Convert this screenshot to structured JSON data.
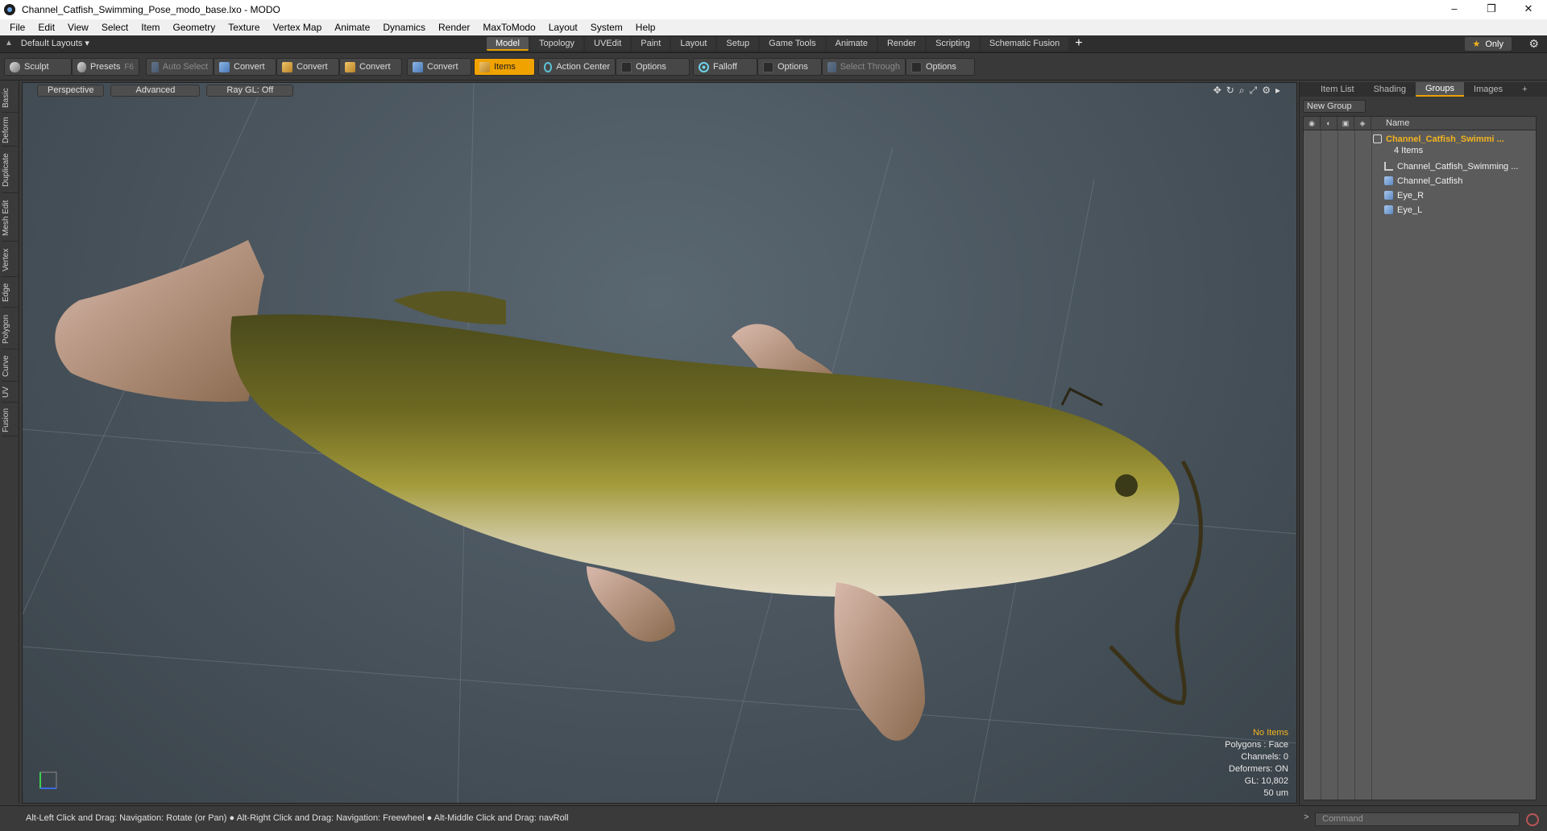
{
  "window": {
    "title": "Channel_Catfish_Swimming_Pose_modo_base.lxo - MODO",
    "controls": [
      "–",
      "❐",
      "✕"
    ]
  },
  "menu": [
    "File",
    "Edit",
    "View",
    "Select",
    "Item",
    "Geometry",
    "Texture",
    "Vertex Map",
    "Animate",
    "Dynamics",
    "Render",
    "MaxToModo",
    "Layout",
    "System",
    "Help"
  ],
  "layout_tabs": {
    "layouts_label": "Default Layouts ▾",
    "tabs": [
      "Model",
      "Topology",
      "UVEdit",
      "Paint",
      "Layout",
      "Setup",
      "Game Tools",
      "Animate",
      "Render",
      "Scripting",
      "Schematic Fusion"
    ],
    "active": "Model",
    "only_label": "Only"
  },
  "toolbar": {
    "sculpt": "Sculpt",
    "presets": "Presets",
    "presets_key": "F6",
    "auto_select": "Auto Select",
    "convert1": "Convert",
    "convert2": "Convert",
    "convert3": "Convert",
    "convert4": "Convert",
    "items": "Items",
    "action_center": "Action Center",
    "options1": "Options",
    "falloff": "Falloff",
    "options2": "Options",
    "select_through": "Select Through",
    "options3": "Options"
  },
  "left_tabs": [
    "Basic",
    "Deform",
    "Duplicate",
    "Mesh Edit",
    "Vertex",
    "Edge",
    "Polygon",
    "Curve",
    "UV",
    "Fusion"
  ],
  "viewport": {
    "view_mode": "Perspective",
    "shading": "Advanced",
    "raygl": "Ray GL: Off",
    "stats": {
      "no_items": "No Items",
      "polygons": "Polygons : Face",
      "channels": "Channels: 0",
      "deformers": "Deformers: ON",
      "gl": "GL: 10,802",
      "scale": "50 um"
    }
  },
  "right_panel": {
    "tabs": [
      "Item List",
      "Shading",
      "Groups",
      "Images"
    ],
    "active_tab": "Groups",
    "new_group": "New Group",
    "name_header": "Name",
    "group_name": "Channel_Catfish_Swimmi ...",
    "group_count": "4 Items",
    "items": [
      "Channel_Catfish_Swimming ...",
      "Channel_Catfish",
      "Eye_R",
      "Eye_L"
    ]
  },
  "statusbar": {
    "hint": "Alt-Left Click and Drag: Navigation: Rotate (or Pan) ● Alt-Right Click and Drag: Navigation: Freewheel ● Alt-Middle Click and Drag: navRoll",
    "command_placeholder": "Command",
    "prompt": ">"
  },
  "colors": {
    "accent": "#f0a300",
    "group_text": "#f2b320"
  }
}
